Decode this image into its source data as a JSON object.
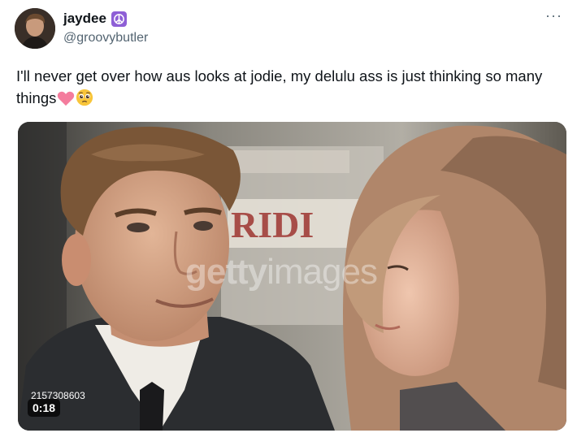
{
  "tweet": {
    "author": {
      "display_name": "jaydee",
      "badge_icon": "peace-sign-icon",
      "badge_color": "#8e5fd6",
      "handle": "@groovybutler"
    },
    "more_label": "···",
    "text": "I'll never get over how aus looks at jodie, my delulu ass is just thinking so many things",
    "emojis": [
      "pink-heart-icon",
      "pleading-face-icon"
    ]
  },
  "media": {
    "watermark_part1": "getty",
    "watermark_part2": "images",
    "image_id": "2157308603",
    "duration": "0:18",
    "background_sign_text": "RIDI"
  }
}
